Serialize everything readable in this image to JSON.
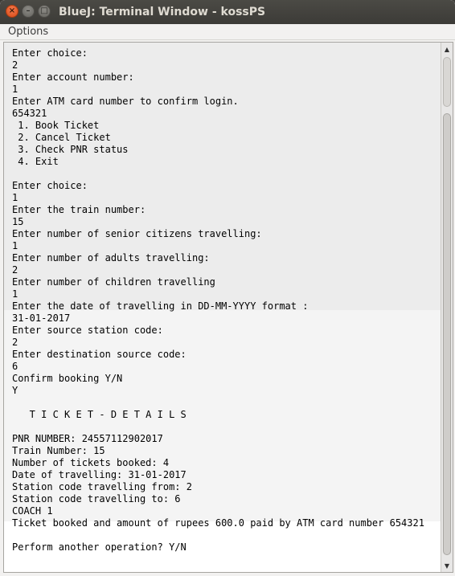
{
  "window": {
    "title": "BlueJ: Terminal Window - kossPS",
    "buttons": {
      "close_glyph": "×",
      "minimize_glyph": "–",
      "maximize_glyph": "□"
    }
  },
  "menubar": {
    "items": [
      {
        "label": "Options"
      }
    ]
  },
  "terminal": {
    "lines": [
      "Enter choice:",
      "2",
      "Enter account number:",
      "1",
      "Enter ATM card number to confirm login.",
      "654321",
      " 1. Book Ticket",
      " 2. Cancel Ticket",
      " 3. Check PNR status",
      " 4. Exit",
      "",
      "Enter choice:",
      "1",
      "Enter the train number:",
      "15",
      "Enter number of senior citizens travelling:",
      "1",
      "Enter number of adults travelling:",
      "2",
      "Enter number of children travelling",
      "1",
      "Enter the date of travelling in DD-MM-YYYY format :",
      "31-01-2017",
      "Enter source station code:",
      "2",
      "Enter destination source code:",
      "6",
      "Confirm booking Y/N",
      "Y",
      "",
      "   T I C K E T - D E T A I L S",
      "",
      "PNR NUMBER: 24557112902017",
      "Train Number: 15",
      "Number of tickets booked: 4",
      "Date of travelling: 31-01-2017",
      "Station code travelling from: 2",
      "Station code travelling to: 6",
      "COACH 1",
      "Ticket booked and amount of rupees 600.0 paid by ATM card number 654321",
      "",
      "Perform another operation? Y/N"
    ]
  },
  "scrollbar": {
    "up_icon": "▲",
    "down_icon": "▼"
  },
  "colors": {
    "titlebar": "#3c3b37",
    "close_button": "#e9541f",
    "terminal_bg": "#ffffff"
  }
}
